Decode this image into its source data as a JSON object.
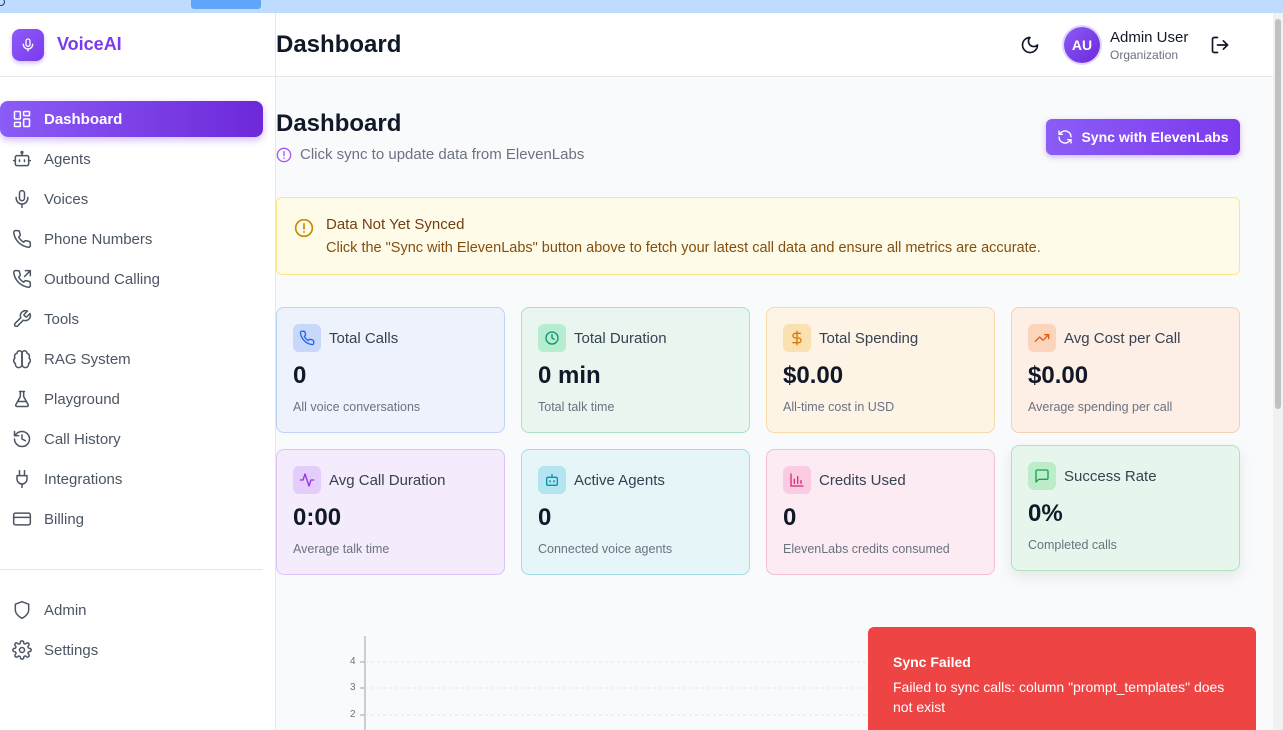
{
  "brand": {
    "name": "VoiceAI",
    "logo_icon": "mic-icon",
    "accent": "#7c3aed"
  },
  "sidebar": {
    "items": [
      {
        "label": "Dashboard",
        "icon": "layout-dashboard-icon",
        "active": true
      },
      {
        "label": "Agents",
        "icon": "bot-icon"
      },
      {
        "label": "Voices",
        "icon": "mic-icon"
      },
      {
        "label": "Phone Numbers",
        "icon": "phone-icon"
      },
      {
        "label": "Outbound Calling",
        "icon": "phone-outgoing-icon"
      },
      {
        "label": "Tools",
        "icon": "wrench-icon"
      },
      {
        "label": "RAG System",
        "icon": "brain-icon"
      },
      {
        "label": "Playground",
        "icon": "flask-icon"
      },
      {
        "label": "Call History",
        "icon": "history-icon"
      },
      {
        "label": "Integrations",
        "icon": "plug-icon"
      },
      {
        "label": "Billing",
        "icon": "credit-card-icon"
      }
    ],
    "bottom_items": [
      {
        "label": "Admin",
        "icon": "shield-icon"
      },
      {
        "label": "Settings",
        "icon": "gear-icon"
      }
    ]
  },
  "header": {
    "title": "Dashboard",
    "user": {
      "initials": "AU",
      "name": "Admin User",
      "org": "Organization"
    }
  },
  "main": {
    "title": "Dashboard",
    "subtitle": "Click sync to update data from ElevenLabs",
    "sync_label": "Sync with ElevenLabs"
  },
  "alert": {
    "title": "Data Not Yet Synced",
    "text": "Click the \"Sync with ElevenLabs\" button above to fetch your latest call data and ensure all metrics are accurate."
  },
  "stats": [
    {
      "title": "Total Calls",
      "value": "0",
      "desc": "All voice conversations",
      "icon": "phone-icon",
      "color": "#2563eb"
    },
    {
      "title": "Total Duration",
      "value": "0 min",
      "desc": "Total talk time",
      "icon": "clock-icon",
      "color": "#059669"
    },
    {
      "title": "Total Spending",
      "value": "$0.00",
      "desc": "All-time cost in USD",
      "icon": "dollar-icon",
      "color": "#d97706"
    },
    {
      "title": "Avg Cost per Call",
      "value": "$0.00",
      "desc": "Average spending per call",
      "icon": "trending-up-icon",
      "color": "#ea580c"
    },
    {
      "title": "Avg Call Duration",
      "value": "0:00",
      "desc": "Average talk time",
      "icon": "activity-icon",
      "color": "#9333ea"
    },
    {
      "title": "Active Agents",
      "value": "0",
      "desc": "Connected voice agents",
      "icon": "bot-icon",
      "color": "#0891b2"
    },
    {
      "title": "Credits Used",
      "value": "0",
      "desc": "ElevenLabs credits consumed",
      "icon": "bar-chart-icon",
      "color": "#db2777"
    },
    {
      "title": "Success Rate",
      "value": "0%",
      "desc": "Completed calls",
      "icon": "message-square-icon",
      "color": "#16a34a"
    }
  ],
  "chart": {
    "y_ticks": [
      "4",
      "3",
      "2"
    ]
  },
  "toast": {
    "title": "Sync Failed",
    "message": "Failed to sync calls: column \"prompt_templates\" does not exist",
    "color": "#ef4444"
  }
}
